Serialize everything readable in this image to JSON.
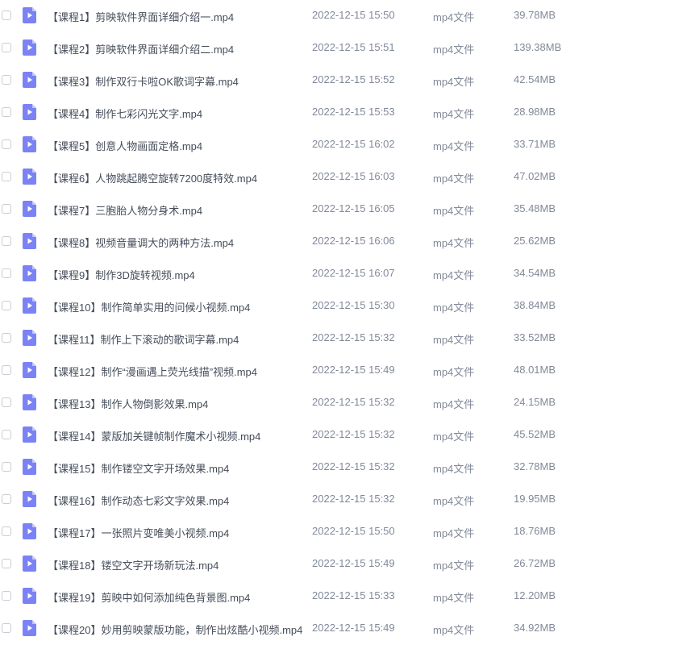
{
  "colors": {
    "icon_body": "#7b83f4",
    "icon_fold": "#c4c8fb",
    "name_text": "#454d5a",
    "meta_text": "#818999",
    "checkbox_border": "#c9ccd3"
  },
  "file_icon": "video-file-icon",
  "files": [
    {
      "name": "【课程1】剪映软件界面详细介绍一.mp4",
      "date": "2022-12-15 15:50",
      "type": "mp4文件",
      "size": "39.78MB"
    },
    {
      "name": "【课程2】剪映软件界面详细介绍二.mp4",
      "date": "2022-12-15 15:51",
      "type": "mp4文件",
      "size": "139.38MB"
    },
    {
      "name": "【课程3】制作双行卡啦OK歌词字幕.mp4",
      "date": "2022-12-15 15:52",
      "type": "mp4文件",
      "size": "42.54MB"
    },
    {
      "name": "【课程4】制作七彩闪光文字.mp4",
      "date": "2022-12-15 15:53",
      "type": "mp4文件",
      "size": "28.98MB"
    },
    {
      "name": "【课程5】创意人物画面定格.mp4",
      "date": "2022-12-15 16:02",
      "type": "mp4文件",
      "size": "33.71MB"
    },
    {
      "name": "【课程6】人物跳起腾空旋转7200度特效.mp4",
      "date": "2022-12-15 16:03",
      "type": "mp4文件",
      "size": "47.02MB"
    },
    {
      "name": "【课程7】三胞胎人物分身术.mp4",
      "date": "2022-12-15 16:05",
      "type": "mp4文件",
      "size": "35.48MB"
    },
    {
      "name": "【课程8】视频音量调大的两种方法.mp4",
      "date": "2022-12-15 16:06",
      "type": "mp4文件",
      "size": "25.62MB"
    },
    {
      "name": "【课程9】制作3D旋转视频.mp4",
      "date": "2022-12-15 16:07",
      "type": "mp4文件",
      "size": "34.54MB"
    },
    {
      "name": "【课程10】制作简单实用的问候小视频.mp4",
      "date": "2022-12-15 15:30",
      "type": "mp4文件",
      "size": "38.84MB"
    },
    {
      "name": "【课程11】制作上下滚动的歌词字幕.mp4",
      "date": "2022-12-15 15:32",
      "type": "mp4文件",
      "size": "33.52MB"
    },
    {
      "name": "【课程12】制作“漫画遇上荧光线描”视频.mp4",
      "date": "2022-12-15 15:49",
      "type": "mp4文件",
      "size": "48.01MB"
    },
    {
      "name": "【课程13】制作人物倒影效果.mp4",
      "date": "2022-12-15 15:32",
      "type": "mp4文件",
      "size": "24.15MB"
    },
    {
      "name": "【课程14】蒙版加关键帧制作魔术小视频.mp4",
      "date": "2022-12-15 15:32",
      "type": "mp4文件",
      "size": "45.52MB"
    },
    {
      "name": "【课程15】制作镂空文字开场效果.mp4",
      "date": "2022-12-15 15:32",
      "type": "mp4文件",
      "size": "32.78MB"
    },
    {
      "name": "【课程16】制作动态七彩文字效果.mp4",
      "date": "2022-12-15 15:32",
      "type": "mp4文件",
      "size": "19.95MB"
    },
    {
      "name": "【课程17】一张照片变唯美小视频.mp4",
      "date": "2022-12-15 15:50",
      "type": "mp4文件",
      "size": "18.76MB"
    },
    {
      "name": "【课程18】镂空文字开场新玩法.mp4",
      "date": "2022-12-15 15:49",
      "type": "mp4文件",
      "size": "26.72MB"
    },
    {
      "name": "【课程19】剪映中如何添加纯色背景图.mp4",
      "date": "2022-12-15 15:33",
      "type": "mp4文件",
      "size": "12.20MB"
    },
    {
      "name": "【课程20】妙用剪映蒙版功能，制作出炫酷小视频.mp4",
      "date": "2022-12-15 15:49",
      "type": "mp4文件",
      "size": "34.92MB"
    }
  ]
}
